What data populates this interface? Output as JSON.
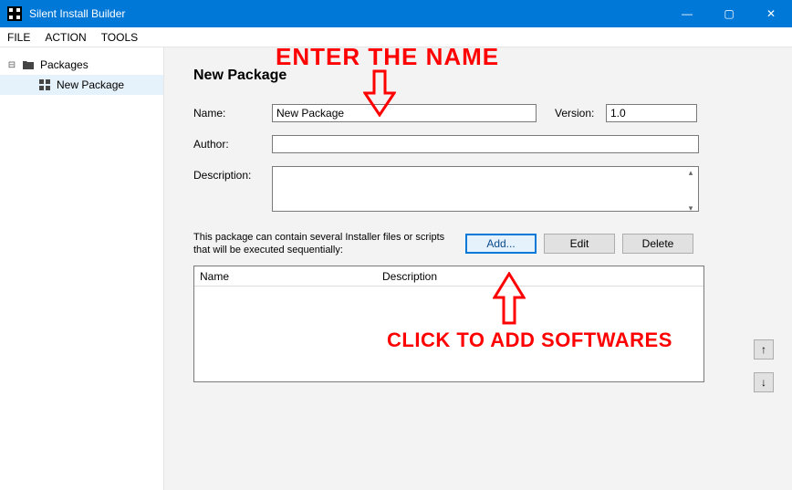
{
  "window": {
    "title": "Silent Install Builder",
    "min": "—",
    "max": "▢",
    "close": "✕"
  },
  "menu": {
    "file": "FILE",
    "action": "ACTION",
    "tools": "TOOLS"
  },
  "sidebar": {
    "root_toggle": "⊟",
    "root_label": "Packages",
    "child_label": "New Package"
  },
  "form": {
    "page_title": "New Package",
    "name_label": "Name:",
    "name_value": "New Package",
    "version_label": "Version:",
    "version_value": "1.0",
    "author_label": "Author:",
    "author_value": "",
    "desc_label": "Description:",
    "desc_value": ""
  },
  "pkg": {
    "hint": "This package can contain several Installer files or scripts that will be executed sequentially:",
    "add": "Add...",
    "edit": "Edit",
    "delete": "Delete",
    "col_name": "Name",
    "col_desc": "Description",
    "up": "↑",
    "down": "↓"
  },
  "annotations": {
    "enter_name": "ENTER THE NAME",
    "click_add": "CLICK TO ADD SOFTWARES"
  }
}
